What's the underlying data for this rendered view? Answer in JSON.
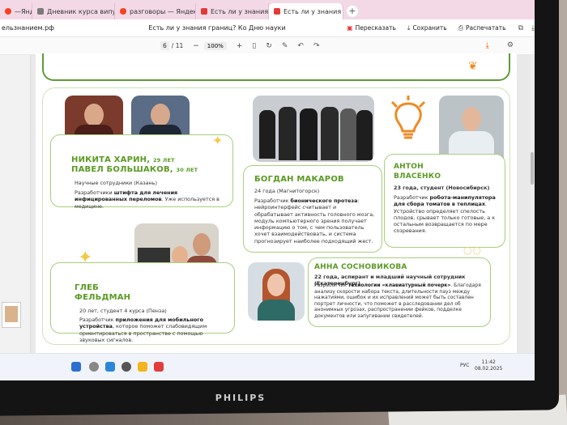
{
  "browser": {
    "tabs": [
      {
        "label": "—Яндекс",
        "icon": "yandex-icon"
      },
      {
        "label": "Дневник курса випуроч",
        "icon": "document-icon"
      },
      {
        "label": "разговоры — Яндекс: на",
        "icon": "yandex-icon"
      },
      {
        "label": "Есть ли у знания границ",
        "icon": "pdf-icon"
      },
      {
        "label": "Есть ли у знания границ",
        "icon": "pdf-icon",
        "active": true
      }
    ],
    "url": "ельзнанием.рф",
    "page_title": "Есть ли у знания границ? Ко Дню науки",
    "buttons": {
      "retell": "Пересказать",
      "save": "Сохранить",
      "print": "Распечатать"
    }
  },
  "pdf_toolbar": {
    "page_current": "6",
    "page_total": "/ 11",
    "zoom": "100%"
  },
  "cards": {
    "harin": {
      "name1": "НИКИТА ХАРИН,",
      "age1": "29 ЛЕТ",
      "name2": "ПАВЕЛ БОЛЬШАКОВ,",
      "age2": "30 ЛЕТ",
      "meta": "Научные сотрудники (Казань)",
      "desc_pre": "Разработчики ",
      "desc_bold": "штифта для лечения инфицированных переломов",
      "desc_post": ". Уже используется в медицине."
    },
    "makarov": {
      "name": "БОГДАН МАКАРОВ",
      "meta": "24 года (Магнитогорск)",
      "desc_pre": "Разработчик ",
      "desc_bold": "бионического протеза",
      "desc_post": ": нейроинтерфейс считывает и обрабатывает активность головного мозга, модуль компьютерного зрения получает информацию о том, с чем пользователь хочет взаимодействовать, и система прогнозирует наиболее подходящий жест."
    },
    "vlasenko": {
      "name1": "АНТОН",
      "name2": "ВЛАСЕНКО",
      "meta": "23 года, студент (Новосибирск)",
      "desc_pre": "Разработчик ",
      "desc_bold": "робота-манипулятора для сбора томатов в теплицах",
      "desc_post": ". Устройство определяет спелость плодов, срывает только готовые, а к остальным возвращается по мере созревания."
    },
    "feldman": {
      "name1": "ГЛЕБ",
      "name2": "ФЕЛЬДМАН",
      "meta": "20 лет, студент 4 курса (Пенза)",
      "desc_pre": "Разработчик ",
      "desc_bold": "приложения для мобильного устройства",
      "desc_post": ", которое поможет слабовидящим ориентироваться в пространстве с помощью звуковых сигналов."
    },
    "sosnovikova": {
      "name": "АННА СОСНОВИКОВА",
      "meta": "22 года, аспирант и младший научный сотрудник (Екатеринбург)",
      "desc_pre": "Разработчик ",
      "desc_bold": "технологии «клавиатурный почерк»",
      "desc_post": ". Благодаря анализу скорости набора текста, длительности пауз между нажатиями, ошибок и их исправлений может быть составлен портрет личности, что поможет в расследовании дел об анонимных угрозах, распространении фейков, подделке документов или запугивании свидетелей."
    }
  },
  "taskbar": {
    "lang": "РУС",
    "time": "11:42",
    "date": "08.02.2025"
  },
  "monitor": {
    "brand": "PHILIPS"
  }
}
